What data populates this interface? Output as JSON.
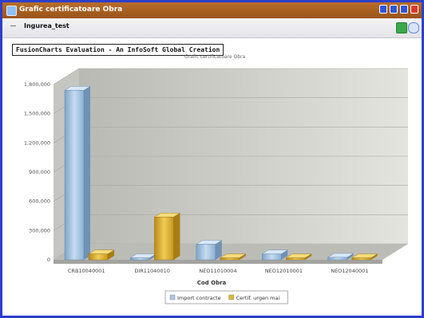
{
  "window": {
    "title": "Grafic certificatoare Obra",
    "app_icon": "app-icon"
  },
  "toolbar": {
    "tab_label": "Ingurea_test",
    "icons": [
      "export-icon",
      "refresh-icon"
    ]
  },
  "evaluation_banner": "FusionCharts Evaluation - An InfoSoft Global Creation",
  "colors": {
    "title_bar": "#a65f22",
    "window_border": "#2c3fcb",
    "series_blue": "#a9c9e6",
    "series_gold": "#e1b531"
  },
  "chart_data": {
    "type": "bar",
    "title": "Grafic certificatoare Obra",
    "xlabel": "Cod Obra",
    "ylabel": "",
    "ylim": [
      0,
      1800000
    ],
    "yticks": [
      "0",
      "300,000",
      "600,000",
      "900,000",
      "1,200,000",
      "1,500,000",
      "1,800,000"
    ],
    "categories": [
      "CRB10040001",
      "DIR11040010",
      "NEO11010004",
      "NEO12010001",
      "NEO12040001"
    ],
    "series": [
      {
        "name": "Import contracte",
        "color": "#a9c9e6",
        "values": [
          1740000,
          20000,
          160000,
          60000,
          25000
        ]
      },
      {
        "name": "Certif. urgen mai",
        "color": "#e1b531",
        "values": [
          60000,
          440000,
          20000,
          20000,
          20000
        ]
      }
    ],
    "grid": true,
    "legend_position": "bottom"
  }
}
